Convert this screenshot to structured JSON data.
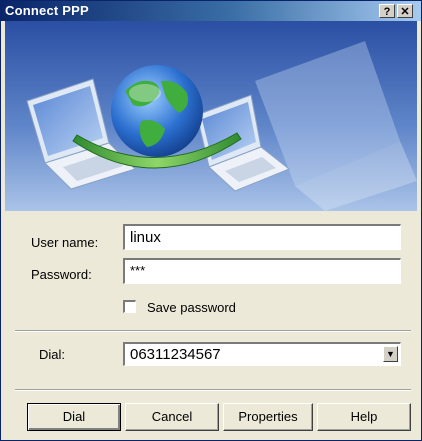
{
  "window": {
    "title": "Connect PPP",
    "help_glyph": "?",
    "close_glyph": "✕"
  },
  "colors": {
    "title_bar": "#0a246a",
    "banner": "#2f55a9",
    "dialog_bg": "#ece9d8"
  },
  "icons": [
    "globe-network-icon",
    "laptop-icon",
    "help-icon",
    "close-icon",
    "chevron-down-icon"
  ],
  "form": {
    "username_label": "User name:",
    "username_value": "linux",
    "password_label": "Password:",
    "password_value": "***",
    "save_password_label": "Save password",
    "save_password_checked": false,
    "dial_label": "Dial:",
    "dial_value": "06311234567"
  },
  "buttons": {
    "dial": "Dial",
    "cancel": "Cancel",
    "properties": "Properties",
    "help": "Help"
  }
}
